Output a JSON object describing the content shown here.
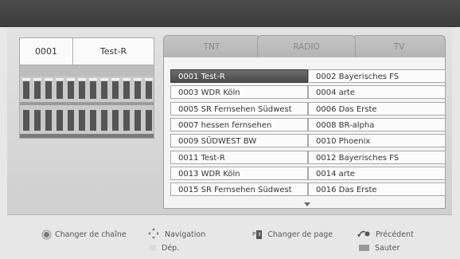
{
  "preview": {
    "number": "0001",
    "name": "Test-R"
  },
  "tabs": [
    {
      "label": "TNT",
      "active": true
    },
    {
      "label": "RADIO",
      "active": false
    },
    {
      "label": "TV",
      "active": false
    }
  ],
  "channels": [
    {
      "label": "0001 Test-R",
      "selected": true
    },
    {
      "label": "0002 Bayerisches FS",
      "selected": false
    },
    {
      "label": "0003 WDR Köln",
      "selected": false
    },
    {
      "label": "0004 arte",
      "selected": false
    },
    {
      "label": "0005 SR Fernsehen Südwest",
      "selected": false
    },
    {
      "label": "0006 Das Erste",
      "selected": false
    },
    {
      "label": "0007 hessen fernsehen",
      "selected": false
    },
    {
      "label": "0008 BR-alpha",
      "selected": false
    },
    {
      "label": "0009 SÜDWEST BW",
      "selected": false
    },
    {
      "label": "0010 Phoenix",
      "selected": false
    },
    {
      "label": "0011 Test-R",
      "selected": false
    },
    {
      "label": "0012 Bayerisches FS",
      "selected": false
    },
    {
      "label": "0013 WDR Köln",
      "selected": false
    },
    {
      "label": "0014 arte",
      "selected": false
    },
    {
      "label": "0015 SR Fernsehen Südwest",
      "selected": false
    },
    {
      "label": "0016 Das Erste",
      "selected": false
    }
  ],
  "legend": {
    "change_channel": "Changer de chaîne",
    "navigation": "Navigation",
    "move": "Dép.",
    "change_page": "Changer de page",
    "page_key": "P",
    "previous": "Précédent",
    "skip": "Sauter"
  },
  "colors": {
    "selected_row": "#5a5a5a",
    "top_bar": "#444444",
    "background": "#e7e7e7"
  }
}
